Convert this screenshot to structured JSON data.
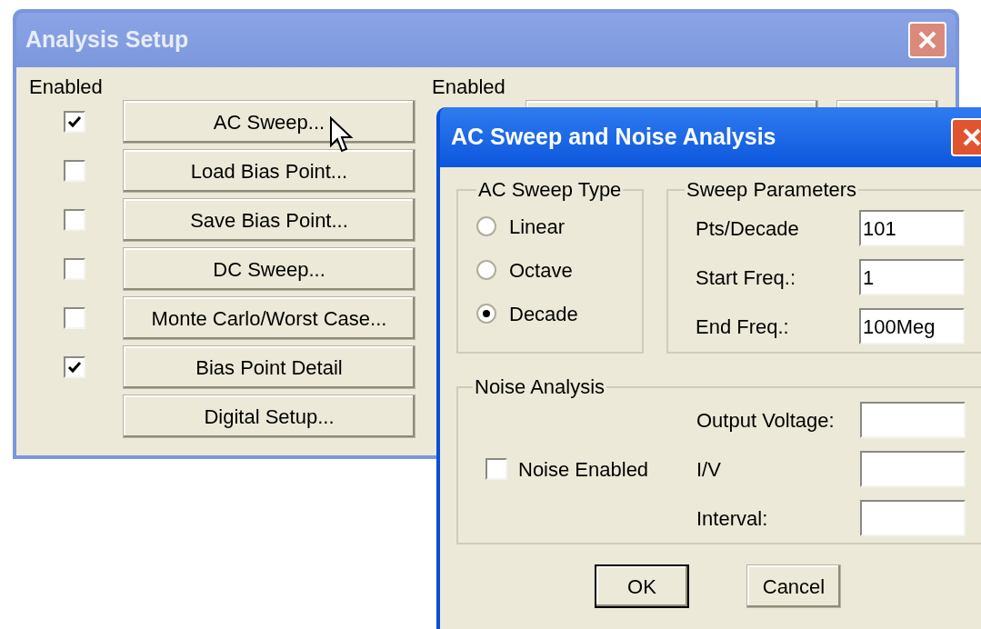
{
  "analysis_setup": {
    "title": "Analysis Setup",
    "enabled_label": "Enabled",
    "second_enabled_label": "Enabled",
    "analyses": [
      {
        "label": "AC Sweep...",
        "checked": true
      },
      {
        "label": "Load Bias Point...",
        "checked": false
      },
      {
        "label": "Save Bias Point...",
        "checked": false
      },
      {
        "label": "DC Sweep...",
        "checked": false
      },
      {
        "label": "Monte Carlo/Worst Case...",
        "checked": false
      },
      {
        "label": "Bias Point Detail",
        "checked": true
      }
    ],
    "digital_setup_button": "Digital Setup..."
  },
  "ac_sweep_dialog": {
    "title": "AC Sweep and Noise Analysis",
    "sweep_type": {
      "title": "AC Sweep Type",
      "options": [
        {
          "label": "Linear",
          "selected": false
        },
        {
          "label": "Octave",
          "selected": false
        },
        {
          "label": "Decade",
          "selected": true
        }
      ]
    },
    "sweep_parameters": {
      "title": "Sweep Parameters",
      "fields": [
        {
          "label": "Pts/Decade",
          "value": "101"
        },
        {
          "label": "Start Freq.:",
          "value": "1"
        },
        {
          "label": "End Freq.:",
          "value": "100Meg"
        }
      ]
    },
    "noise_analysis": {
      "title": "Noise Analysis",
      "noise_enabled": {
        "label": "Noise Enabled",
        "checked": false
      },
      "fields": [
        {
          "label": "Output Voltage:"
        },
        {
          "label": "I/V"
        },
        {
          "label": "Interval:"
        }
      ]
    },
    "buttons": [
      {
        "label": "OK",
        "default": true
      },
      {
        "label": "Cancel",
        "default": false
      }
    ]
  }
}
